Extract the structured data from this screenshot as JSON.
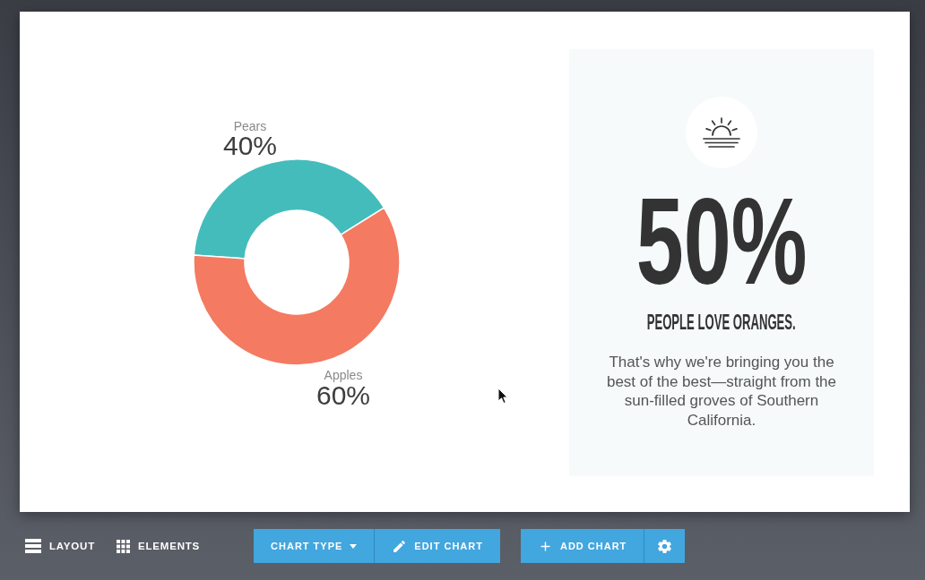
{
  "canvas": {
    "chart": {
      "chart_data": {
        "type": "donut",
        "categories": [
          "Pears",
          "Apples"
        ],
        "values": [
          40,
          60
        ],
        "value_labels": [
          "40%",
          "60%"
        ],
        "colors": [
          "#45bcbc",
          "#f47a62"
        ]
      }
    },
    "stat_card": {
      "figure": "50%",
      "headline": "PEOPLE LOVE ORANGES.",
      "body": "That's why we're bringing you the best of the best—straight from the sun-filled groves of Southern California."
    }
  },
  "toolbar": {
    "left_items": [
      {
        "kind": "layout",
        "label": "LAYOUT"
      },
      {
        "kind": "elements",
        "label": "ELEMENTS"
      }
    ],
    "button_groups": [
      [
        {
          "kind": "dropdown",
          "label": "CHART TYPE"
        },
        {
          "kind": "edit",
          "label": "EDIT CHART"
        }
      ],
      [
        {
          "kind": "add",
          "label": "ADD CHART"
        },
        {
          "kind": "settings"
        }
      ]
    ]
  }
}
